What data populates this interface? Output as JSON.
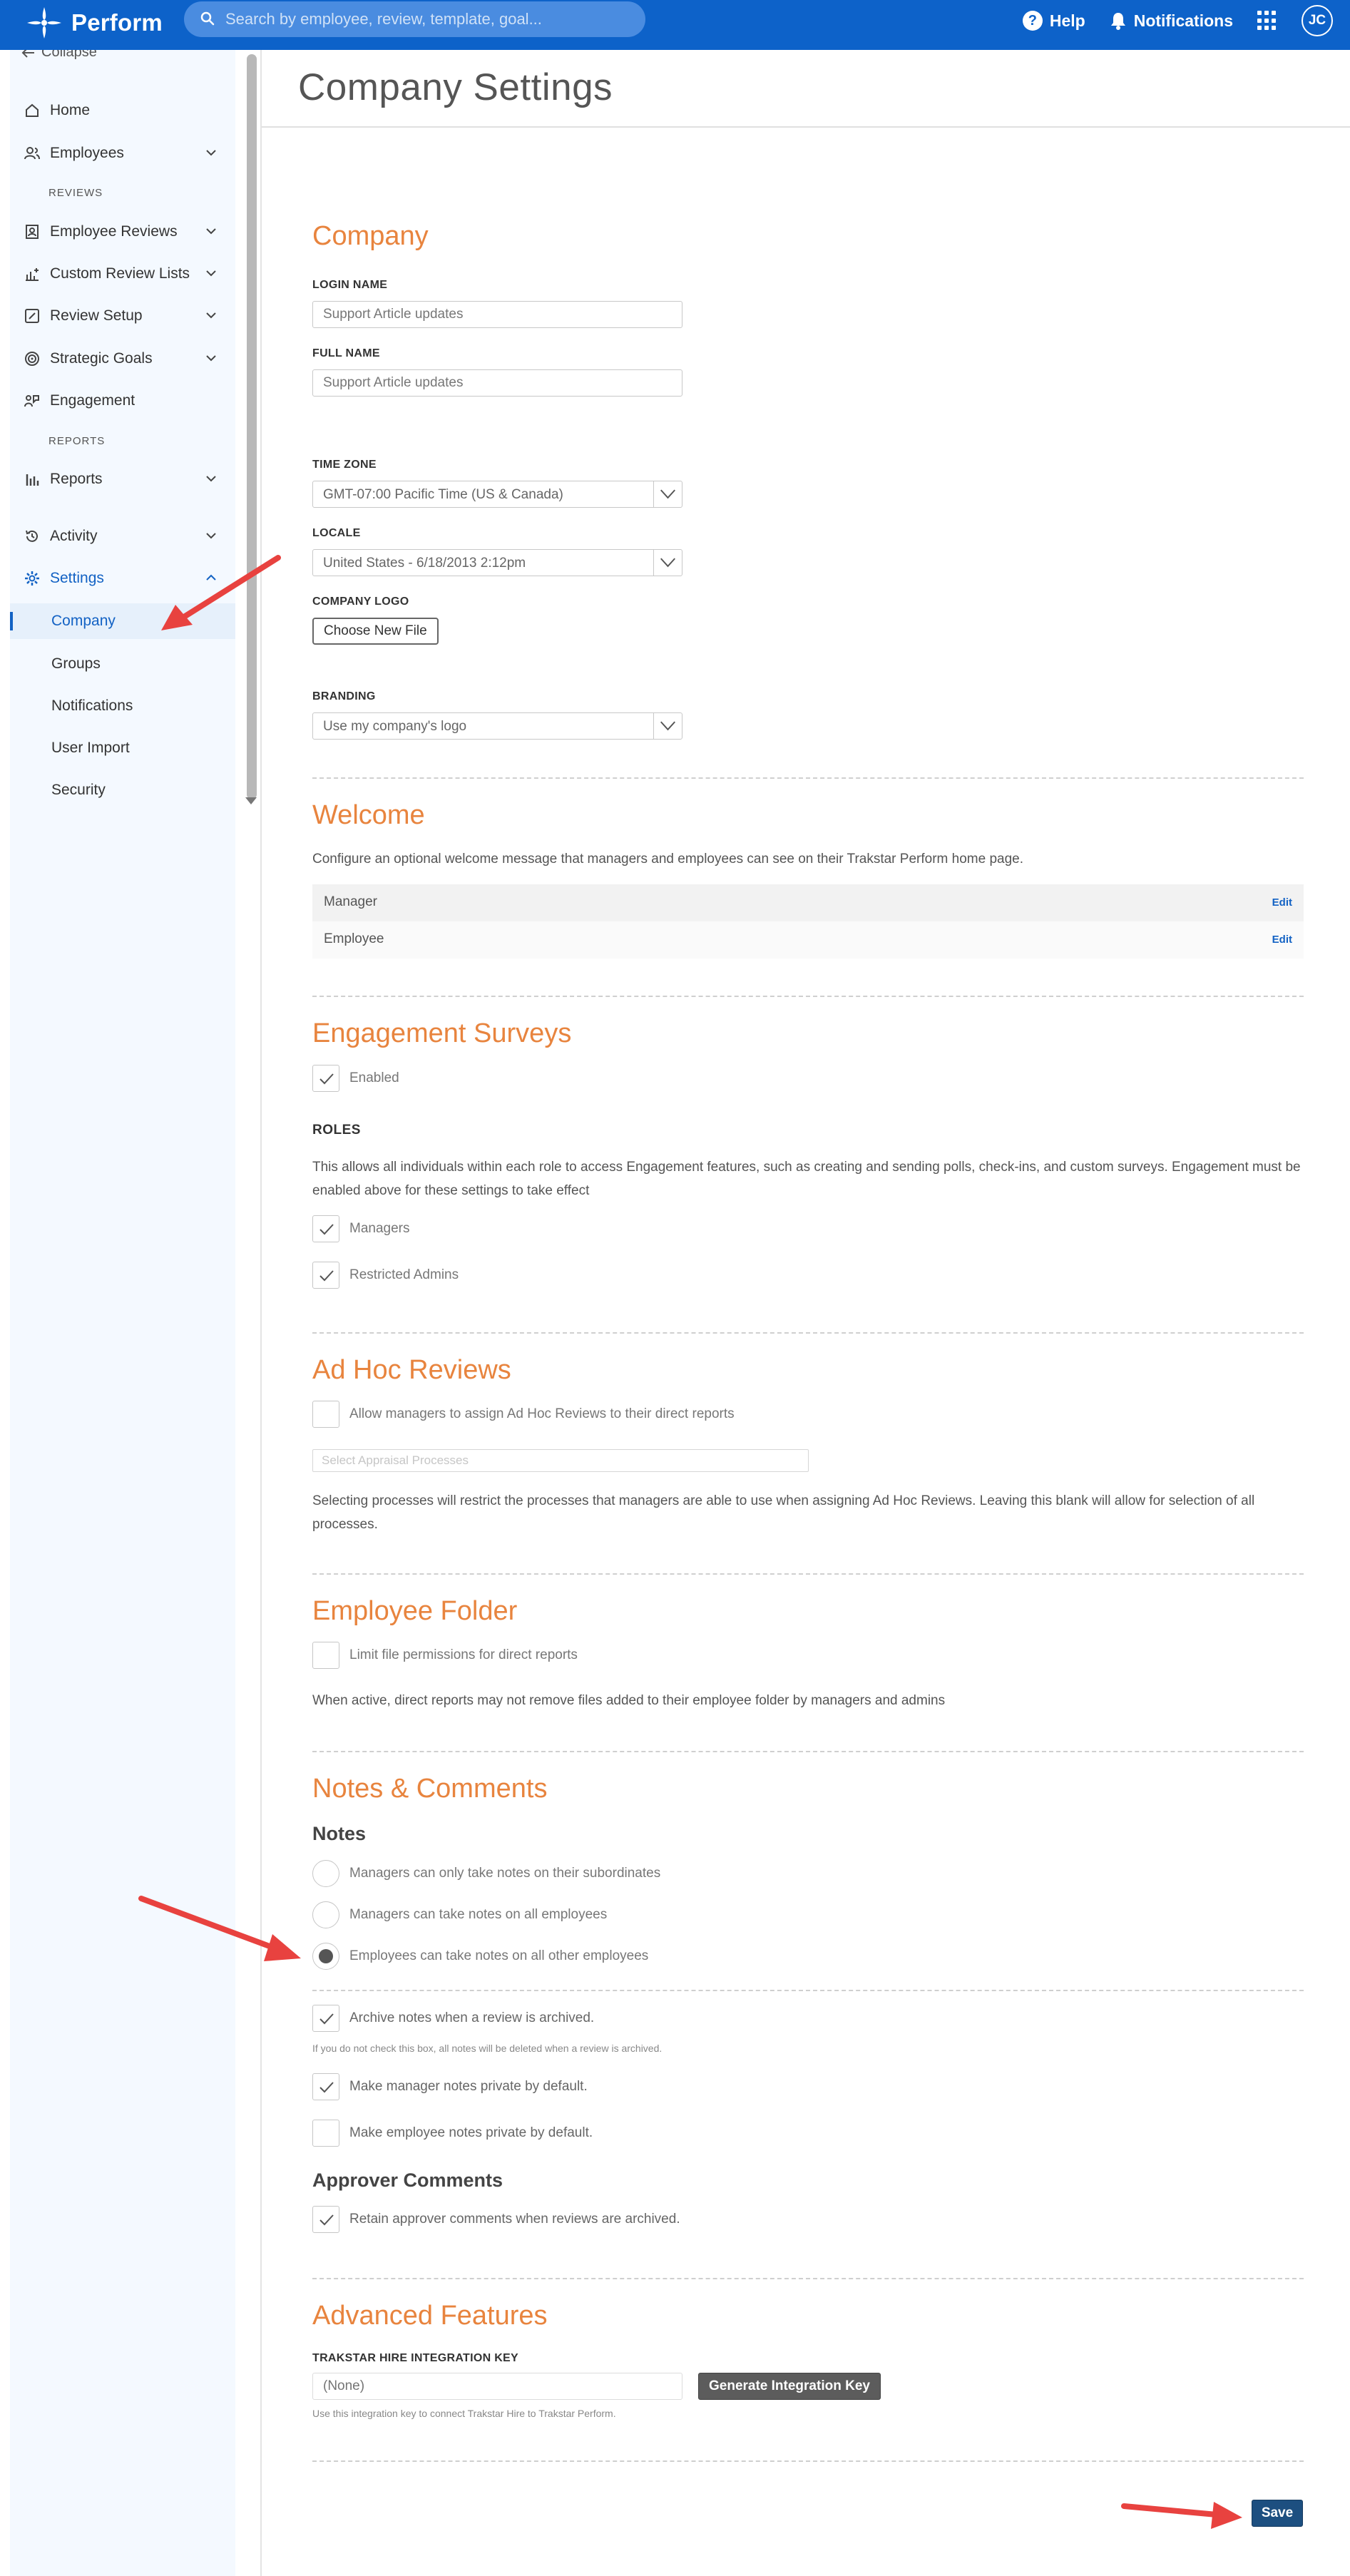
{
  "topbar": {
    "app_name": "Perform",
    "search_placeholder": "Search by employee, review, template, goal...",
    "help_label": "Help",
    "notifications_label": "Notifications",
    "avatar_initials": "JC"
  },
  "sidebar": {
    "collapse_label": "Collapse",
    "items": {
      "home": "Home",
      "employees": "Employees",
      "reviews_section": "REVIEWS",
      "employee_reviews": "Employee Reviews",
      "custom_review_lists": "Custom Review Lists",
      "review_setup": "Review Setup",
      "strategic_goals": "Strategic Goals",
      "engagement": "Engagement",
      "reports_section": "REPORTS",
      "reports": "Reports",
      "activity": "Activity",
      "settings": "Settings",
      "company": "Company",
      "groups": "Groups",
      "notifications": "Notifications",
      "user_import": "User Import",
      "security": "Security"
    }
  },
  "page": {
    "title": "Company Settings"
  },
  "company": {
    "title": "Company",
    "login_name_label": "LOGIN NAME",
    "login_name_value": "Support Article updates",
    "full_name_label": "FULL NAME",
    "full_name_value": "Support Article updates",
    "time_zone_label": "TIME ZONE",
    "time_zone_value": "GMT-07:00 Pacific Time (US & Canada)",
    "locale_label": "LOCALE",
    "locale_value": "United States - 6/18/2013 2:12pm",
    "logo_label": "COMPANY LOGO",
    "choose_file": "Choose New File",
    "branding_label": "BRANDING",
    "branding_value": "Use my company's logo"
  },
  "welcome": {
    "title": "Welcome",
    "description": "Configure an optional welcome message that managers and employees can see on their Trakstar Perform home page.",
    "rows": [
      {
        "label": "Manager",
        "action": "Edit"
      },
      {
        "label": "Employee",
        "action": "Edit"
      }
    ]
  },
  "engagement": {
    "title": "Engagement Surveys",
    "enabled_label": "Enabled",
    "roles_label": "ROLES",
    "roles_description": "This allows all individuals within each role to access Engagement features, such as creating and sending polls, check-ins, and custom surveys. Engagement must be enabled above for these settings to take effect",
    "managers_label": "Managers",
    "restricted_admins_label": "Restricted Admins"
  },
  "adhoc": {
    "title": "Ad Hoc Reviews",
    "allow_label": "Allow managers to assign Ad Hoc Reviews to their direct reports",
    "select_placeholder": "Select Appraisal Processes",
    "description": "Selecting processes will restrict the processes that managers are able to use when assigning Ad Hoc Reviews. Leaving this blank will allow for selection of all processes."
  },
  "folder": {
    "title": "Employee Folder",
    "limit_label": "Limit file permissions for direct reports",
    "description": "When active, direct reports may not remove files added to their employee folder by managers and admins"
  },
  "notes": {
    "title": "Notes & Comments",
    "notes_heading": "Notes",
    "radio_1": "Managers can only take notes on their subordinates",
    "radio_2": "Managers can take notes on all employees",
    "radio_3": "Employees can take notes on all other employees",
    "archive_label": "Archive notes when a review is archived.",
    "archive_note": "If you do not check this box, all notes will be deleted when a review is archived.",
    "manager_private_label": "Make manager notes private by default.",
    "employee_private_label": "Make employee notes private by default.",
    "approver_heading": "Approver Comments",
    "retain_label": "Retain approver comments when reviews are archived."
  },
  "advanced": {
    "title": "Advanced Features",
    "key_label": "TRAKSTAR HIRE INTEGRATION KEY",
    "key_placeholder": "(None)",
    "generate_label": "Generate Integration Key",
    "key_note": "Use this integration key to connect Trakstar Hire to Trakstar Perform."
  },
  "actions": {
    "save_label": "Save"
  },
  "colors": {
    "topbar": "#0d62c9",
    "accent_orange": "#e8843e",
    "save_button": "#1d4f80",
    "annotation_arrow": "#e8423f"
  }
}
